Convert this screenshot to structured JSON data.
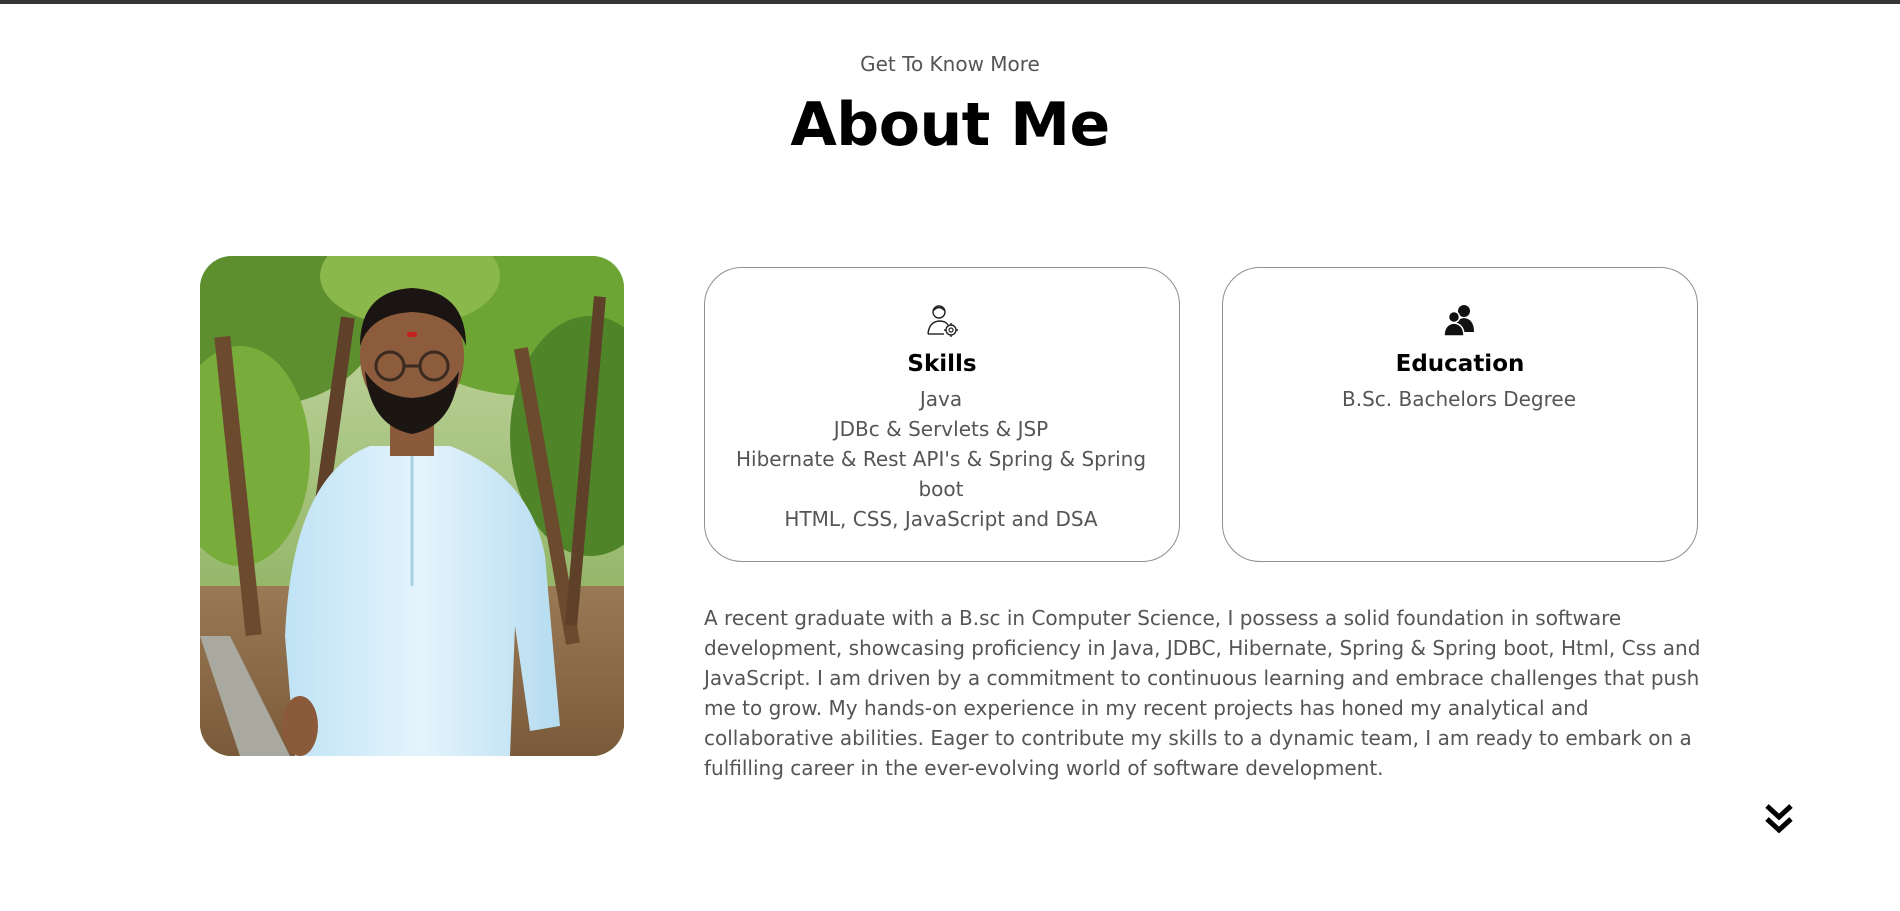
{
  "header": {
    "subtitle": "Get To Know More",
    "title": "About Me"
  },
  "profile": {
    "photo_alt": "Profile picture"
  },
  "cards": {
    "skills": {
      "icon": "experience-icon",
      "title": "Skills",
      "lines": [
        "Java",
        "JDBc & Servlets & JSP",
        "Hibernate & Rest API's & Spring & Spring boot",
        "HTML, CSS, JavaScript and DSA"
      ]
    },
    "education": {
      "icon": "education-icon",
      "title": "Education",
      "lines": [
        "B.Sc. Bachelors Degree"
      ]
    }
  },
  "bio": {
    "text": "A recent graduate with a B.sc in Computer Science, I possess a solid foundation in software development, showcasing proficiency in Java, JDBC, Hibernate, Spring & Spring boot, Html, Css and JavaScript. I am driven by a commitment to continuous learning and embrace challenges that push me to grow. My hands-on experience in my recent projects has honed my analytical and collaborative abilities. Eager to contribute my skills to a dynamic team, I am ready to embark on a fulfilling career in the ever-evolving world of software development."
  },
  "navigation": {
    "scroll_icon": "double-chevron-down-icon"
  },
  "colors": {
    "topbar": "#353535",
    "title": "#000000",
    "body_text": "#555555",
    "card_border": "#8f8f8f"
  }
}
